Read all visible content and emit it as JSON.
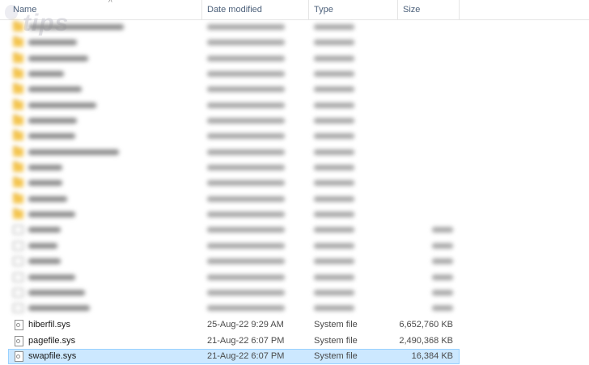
{
  "header": {
    "col_name": "Name",
    "col_date": "Date modified",
    "col_type": "Type",
    "col_size": "Size"
  },
  "watermark": "tips",
  "blurred_rows": [
    {
      "icon": "folder-icon"
    },
    {
      "icon": "folder-icon"
    },
    {
      "icon": "folder-icon"
    },
    {
      "icon": "folder-icon"
    },
    {
      "icon": "folder-icon"
    },
    {
      "icon": "folder-icon"
    },
    {
      "icon": "folder-icon"
    },
    {
      "icon": "folder-icon"
    },
    {
      "icon": "folder-icon"
    },
    {
      "icon": "folder-icon"
    },
    {
      "icon": "folder-icon"
    },
    {
      "icon": "folder-icon"
    },
    {
      "icon": "folder-icon"
    },
    {
      "icon": "file-icon"
    },
    {
      "icon": "file-icon"
    },
    {
      "icon": "file-icon"
    },
    {
      "icon": "file-icon"
    },
    {
      "icon": "file-icon"
    },
    {
      "icon": "file-icon"
    }
  ],
  "files": [
    {
      "name": "hiberfil.sys",
      "date": "25-Aug-22 9:29 AM",
      "type": "System file",
      "size": "6,652,760 KB",
      "selected": false
    },
    {
      "name": "pagefile.sys",
      "date": "21-Aug-22 6:07 PM",
      "type": "System file",
      "size": "2,490,368 KB",
      "selected": false
    },
    {
      "name": "swapfile.sys",
      "date": "21-Aug-22 6:07 PM",
      "type": "System file",
      "size": "16,384 KB",
      "selected": true
    }
  ]
}
